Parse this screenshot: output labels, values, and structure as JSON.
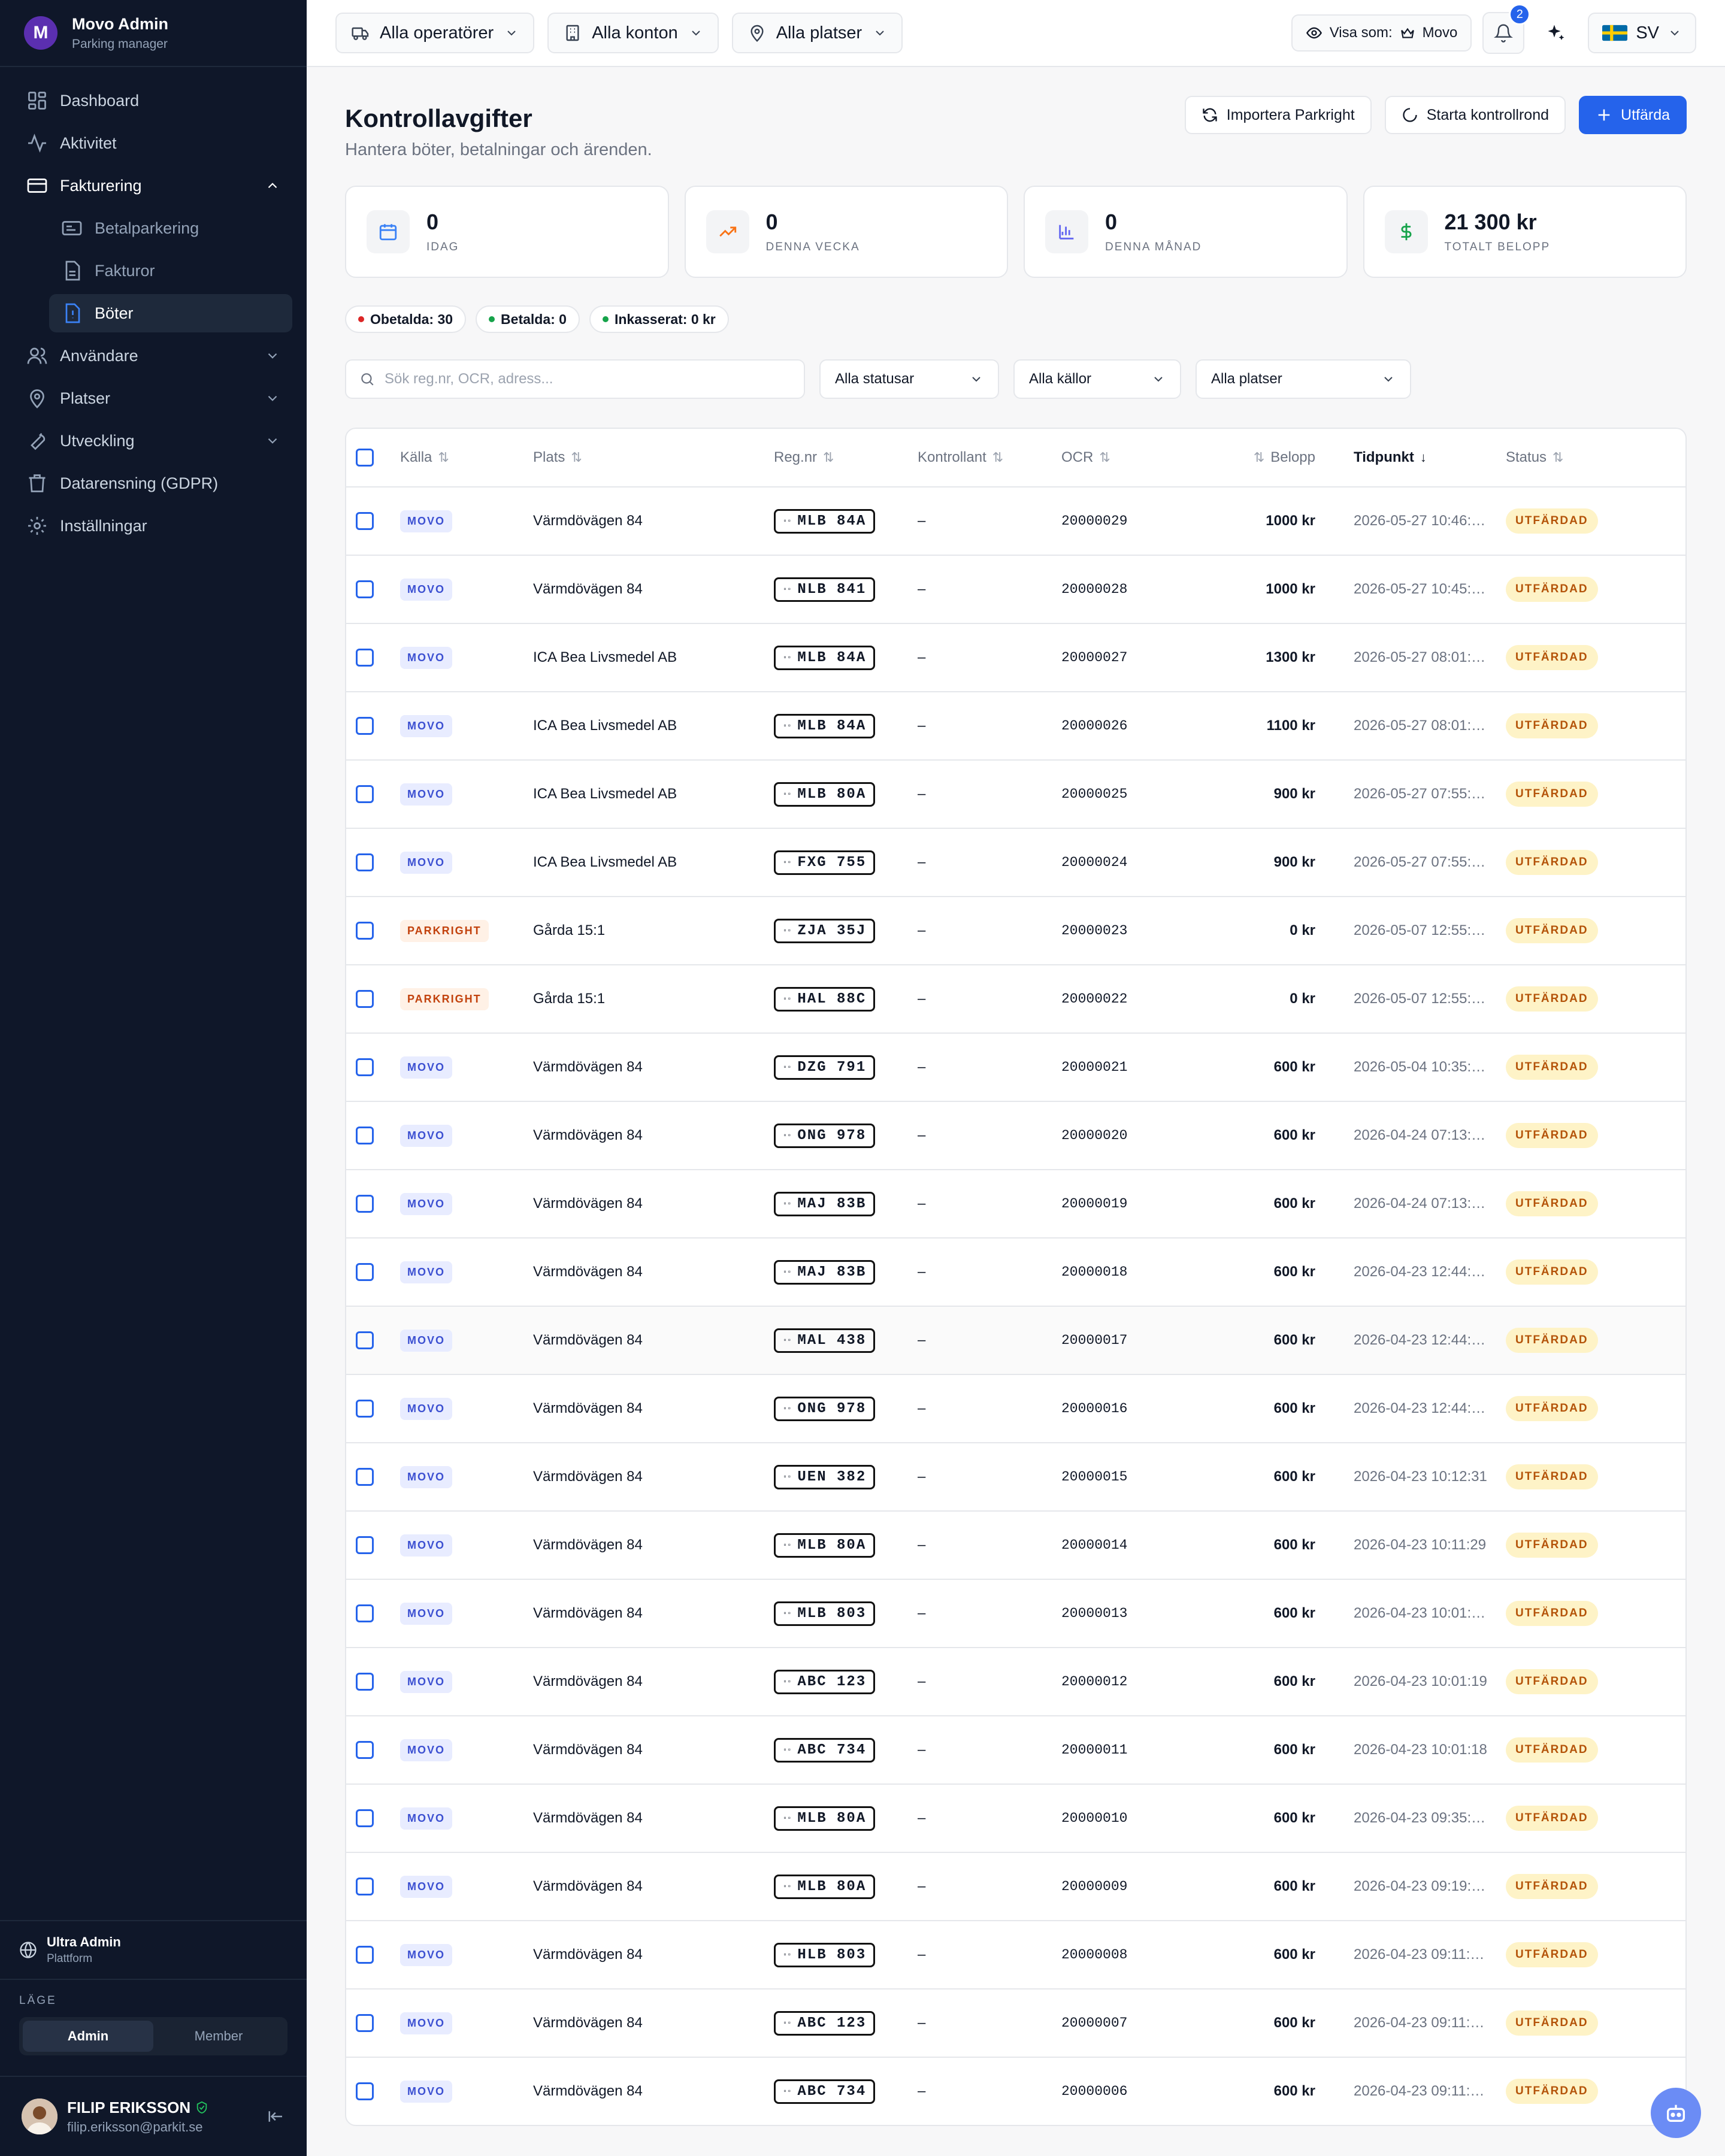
{
  "app": {
    "name": "Movo Admin",
    "subtitle": "Parking manager",
    "logo_letter": "M"
  },
  "nav": {
    "items": [
      {
        "label": "Dashboard",
        "icon": "grid-icon"
      },
      {
        "label": "Aktivitet",
        "icon": "activity-icon"
      },
      {
        "label": "Fakturering",
        "icon": "credit-card-icon",
        "expanded": true
      },
      {
        "label": "Användare",
        "icon": "users-icon"
      },
      {
        "label": "Platser",
        "icon": "map-pin-icon"
      },
      {
        "label": "Utveckling",
        "icon": "wrench-icon"
      },
      {
        "label": "Datarensning (GDPR)",
        "icon": "trash-icon"
      },
      {
        "label": "Inställningar",
        "icon": "gear-icon"
      }
    ],
    "sub": [
      {
        "label": "Betalparkering",
        "icon": "parking-icon"
      },
      {
        "label": "Fakturor",
        "icon": "file-icon"
      },
      {
        "label": "Böter",
        "icon": "alert-file-icon",
        "active": true
      }
    ]
  },
  "org": {
    "name": "Ultra Admin",
    "sub": "Plattform"
  },
  "mode": {
    "label": "LÄGE",
    "options": [
      "Admin",
      "Member"
    ],
    "selected": "Admin"
  },
  "user": {
    "name": "FILIP ERIKSSON",
    "email": "filip.eriksson@parkit.se"
  },
  "topbar": {
    "operators": "Alla operatörer",
    "accounts": "Alla konton",
    "places": "Alla platser",
    "view_as_label": "Visa som:",
    "view_as_value": "Movo",
    "notifications": "2",
    "language": "SV"
  },
  "page": {
    "title": "Kontrollavgifter",
    "subtitle": "Hantera böter, betalningar och ärenden.",
    "actions": {
      "import": "Importera Parkright",
      "round": "Starta kontrollrond",
      "issue": "Utfärda"
    }
  },
  "stats": [
    {
      "value": "0",
      "label": "IDAG",
      "icon": "calendar-icon",
      "color": "#3b82f6"
    },
    {
      "value": "0",
      "label": "DENNA VECKA",
      "icon": "trend-up-icon",
      "color": "#f97316"
    },
    {
      "value": "0",
      "label": "DENNA MÅNAD",
      "icon": "bar-chart-icon",
      "color": "#6366f1"
    },
    {
      "value": "21 300 kr",
      "label": "TOTALT BELOPP",
      "icon": "dollar-icon",
      "color": "#16a34a"
    }
  ],
  "pills": [
    {
      "label": "Obetalda: 30",
      "color": "#dc2626"
    },
    {
      "label": "Betalda: 0",
      "color": "#16a34a"
    },
    {
      "label": "Inkasserat: 0 kr",
      "color": "#16a34a"
    }
  ],
  "filters": {
    "search_placeholder": "Sök reg.nr, OCR, adress...",
    "status": "Alla statusar",
    "sources": "Alla källor",
    "places": "Alla platser"
  },
  "table": {
    "headers": [
      "Källa",
      "Plats",
      "Reg.nr",
      "Kontrollant",
      "OCR",
      "Belopp",
      "Tidpunkt",
      "Status"
    ],
    "rows": [
      {
        "src": "MOVO",
        "place": "Värmdövägen 84",
        "reg": "MLB 84A",
        "ctrl": "–",
        "ocr": "20000029",
        "amount": "1000 kr",
        "time": "2026-05-27 10:46:…",
        "status": "UTFÄRDAD"
      },
      {
        "src": "MOVO",
        "place": "Värmdövägen 84",
        "reg": "NLB 841",
        "ctrl": "–",
        "ocr": "20000028",
        "amount": "1000 kr",
        "time": "2026-05-27 10:45:…",
        "status": "UTFÄRDAD"
      },
      {
        "src": "MOVO",
        "place": "ICA Bea Livsmedel AB",
        "reg": "MLB 84A",
        "ctrl": "–",
        "ocr": "20000027",
        "amount": "1300 kr",
        "time": "2026-05-27 08:01:…",
        "status": "UTFÄRDAD"
      },
      {
        "src": "MOVO",
        "place": "ICA Bea Livsmedel AB",
        "reg": "MLB 84A",
        "ctrl": "–",
        "ocr": "20000026",
        "amount": "1100 kr",
        "time": "2026-05-27 08:01:…",
        "status": "UTFÄRDAD"
      },
      {
        "src": "MOVO",
        "place": "ICA Bea Livsmedel AB",
        "reg": "MLB 80A",
        "ctrl": "–",
        "ocr": "20000025",
        "amount": "900 kr",
        "time": "2026-05-27 07:55:…",
        "status": "UTFÄRDAD"
      },
      {
        "src": "MOVO",
        "place": "ICA Bea Livsmedel AB",
        "reg": "FXG 755",
        "ctrl": "–",
        "ocr": "20000024",
        "amount": "900 kr",
        "time": "2026-05-27 07:55:…",
        "status": "UTFÄRDAD"
      },
      {
        "src": "PARKRIGHT",
        "place": "Gårda 15:1",
        "reg": "ZJA 35J",
        "ctrl": "–",
        "ocr": "20000023",
        "amount": "0 kr",
        "time": "2026-05-07 12:55:…",
        "status": "UTFÄRDAD"
      },
      {
        "src": "PARKRIGHT",
        "place": "Gårda 15:1",
        "reg": "HAL 88C",
        "ctrl": "–",
        "ocr": "20000022",
        "amount": "0 kr",
        "time": "2026-05-07 12:55:…",
        "status": "UTFÄRDAD"
      },
      {
        "src": "MOVO",
        "place": "Värmdövägen 84",
        "reg": "DZG 791",
        "ctrl": "–",
        "ocr": "20000021",
        "amount": "600 kr",
        "time": "2026-05-04 10:35:…",
        "status": "UTFÄRDAD"
      },
      {
        "src": "MOVO",
        "place": "Värmdövägen 84",
        "reg": "ONG 978",
        "ctrl": "–",
        "ocr": "20000020",
        "amount": "600 kr",
        "time": "2026-04-24 07:13:…",
        "status": "UTFÄRDAD"
      },
      {
        "src": "MOVO",
        "place": "Värmdövägen 84",
        "reg": "MAJ 83B",
        "ctrl": "–",
        "ocr": "20000019",
        "amount": "600 kr",
        "time": "2026-04-24 07:13:…",
        "status": "UTFÄRDAD"
      },
      {
        "src": "MOVO",
        "place": "Värmdövägen 84",
        "reg": "MAJ 83B",
        "ctrl": "–",
        "ocr": "20000018",
        "amount": "600 kr",
        "time": "2026-04-23 12:44:…",
        "status": "UTFÄRDAD"
      },
      {
        "src": "MOVO",
        "place": "Värmdövägen 84",
        "reg": "MAL 438",
        "ctrl": "–",
        "ocr": "20000017",
        "amount": "600 kr",
        "time": "2026-04-23 12:44:…",
        "status": "UTFÄRDAD"
      },
      {
        "src": "MOVO",
        "place": "Värmdövägen 84",
        "reg": "ONG 978",
        "ctrl": "–",
        "ocr": "20000016",
        "amount": "600 kr",
        "time": "2026-04-23 12:44:…",
        "status": "UTFÄRDAD"
      },
      {
        "src": "MOVO",
        "place": "Värmdövägen 84",
        "reg": "UEN 382",
        "ctrl": "–",
        "ocr": "20000015",
        "amount": "600 kr",
        "time": "2026-04-23 10:12:31",
        "status": "UTFÄRDAD"
      },
      {
        "src": "MOVO",
        "place": "Värmdövägen 84",
        "reg": "MLB 80A",
        "ctrl": "–",
        "ocr": "20000014",
        "amount": "600 kr",
        "time": "2026-04-23 10:11:29",
        "status": "UTFÄRDAD"
      },
      {
        "src": "MOVO",
        "place": "Värmdövägen 84",
        "reg": "MLB 803",
        "ctrl": "–",
        "ocr": "20000013",
        "amount": "600 kr",
        "time": "2026-04-23 10:01:…",
        "status": "UTFÄRDAD"
      },
      {
        "src": "MOVO",
        "place": "Värmdövägen 84",
        "reg": "ABC 123",
        "ctrl": "–",
        "ocr": "20000012",
        "amount": "600 kr",
        "time": "2026-04-23 10:01:19",
        "status": "UTFÄRDAD"
      },
      {
        "src": "MOVO",
        "place": "Värmdövägen 84",
        "reg": "ABC 734",
        "ctrl": "–",
        "ocr": "20000011",
        "amount": "600 kr",
        "time": "2026-04-23 10:01:18",
        "status": "UTFÄRDAD"
      },
      {
        "src": "MOVO",
        "place": "Värmdövägen 84",
        "reg": "MLB 80A",
        "ctrl": "–",
        "ocr": "20000010",
        "amount": "600 kr",
        "time": "2026-04-23 09:35:…",
        "status": "UTFÄRDAD"
      },
      {
        "src": "MOVO",
        "place": "Värmdövägen 84",
        "reg": "MLB 80A",
        "ctrl": "–",
        "ocr": "20000009",
        "amount": "600 kr",
        "time": "2026-04-23 09:19:…",
        "status": "UTFÄRDAD"
      },
      {
        "src": "MOVO",
        "place": "Värmdövägen 84",
        "reg": "HLB 803",
        "ctrl": "–",
        "ocr": "20000008",
        "amount": "600 kr",
        "time": "2026-04-23 09:11:…",
        "status": "UTFÄRDAD"
      },
      {
        "src": "MOVO",
        "place": "Värmdövägen 84",
        "reg": "ABC 123",
        "ctrl": "–",
        "ocr": "20000007",
        "amount": "600 kr",
        "time": "2026-04-23 09:11:…",
        "status": "UTFÄRDAD"
      },
      {
        "src": "MOVO",
        "place": "Värmdövägen 84",
        "reg": "ABC 734",
        "ctrl": "–",
        "ocr": "20000006",
        "amount": "600 kr",
        "time": "2026-04-23 09:11:…",
        "status": "UTFÄRDAD"
      }
    ]
  }
}
